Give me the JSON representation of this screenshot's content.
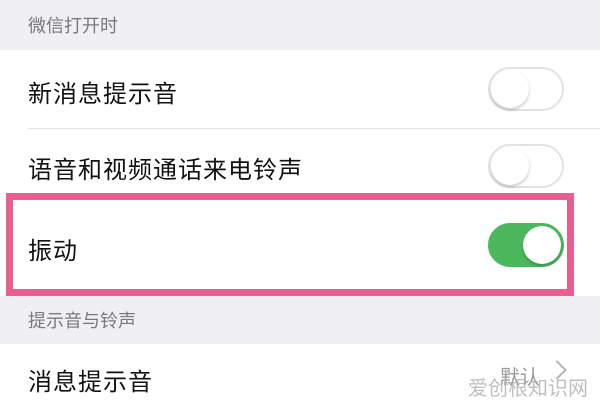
{
  "sections": [
    {
      "header": "微信打开时",
      "rows": [
        {
          "label": "新消息提示音",
          "toggle": "off"
        },
        {
          "label": "语音和视频通话来电铃声",
          "toggle": "off"
        },
        {
          "label": "振动",
          "toggle": "on"
        }
      ]
    },
    {
      "header": "提示音与铃声",
      "rows": [
        {
          "label": "消息提示音",
          "value": "默认"
        }
      ]
    }
  ],
  "watermark": "爱创根知识网",
  "colors": {
    "toggle_on": "#4cb85e",
    "highlight_border": "#e85e8f",
    "section_header_bg": "#efeff4"
  }
}
